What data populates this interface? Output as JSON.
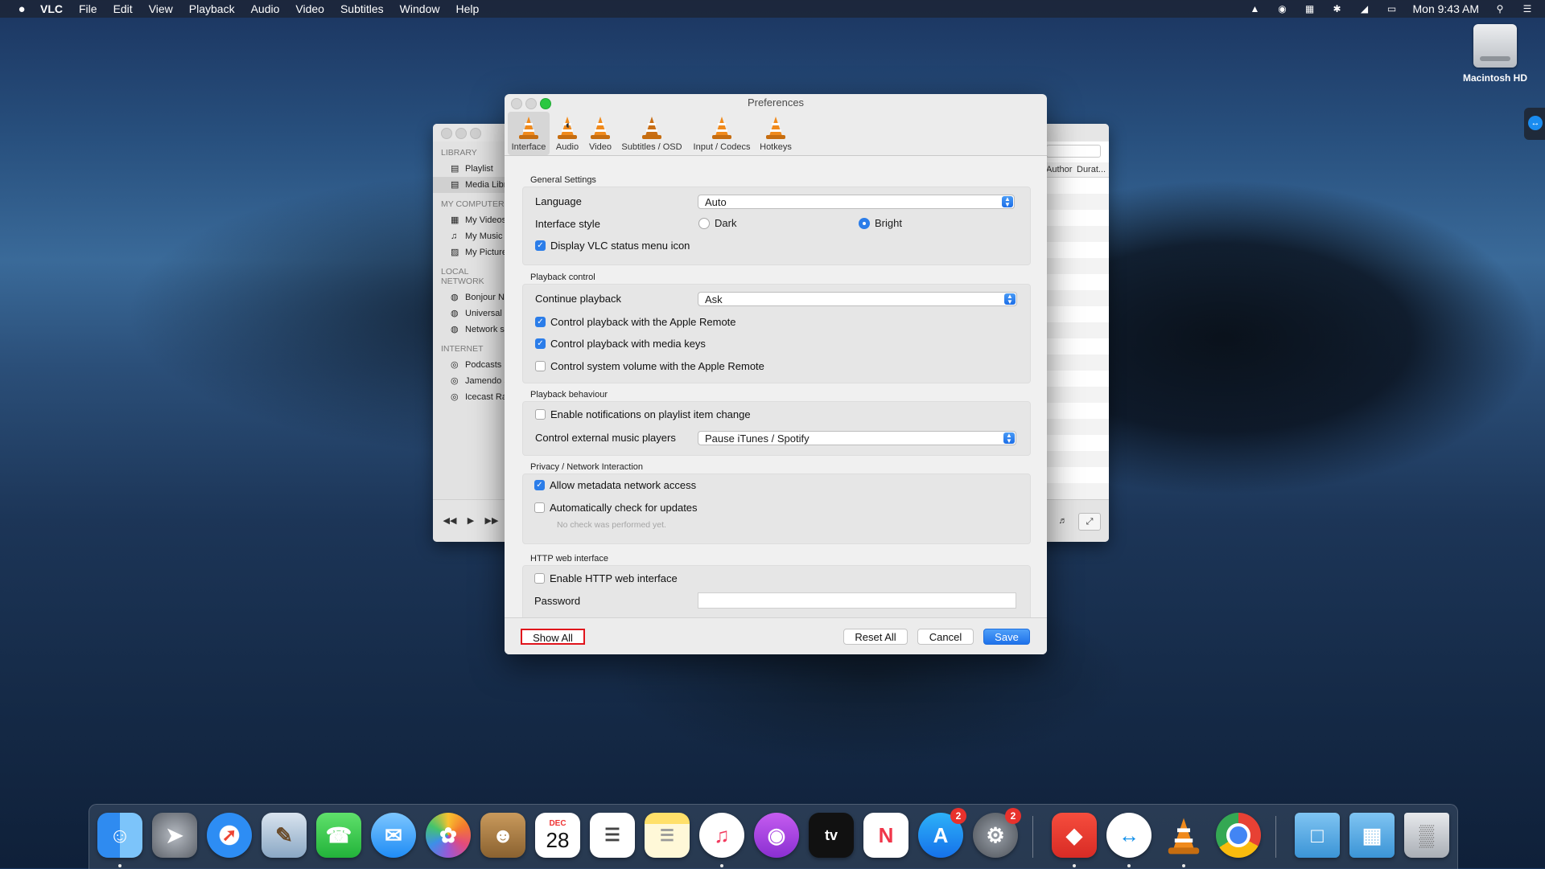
{
  "menubar": {
    "apple": "",
    "app": "VLC",
    "items": [
      "File",
      "Edit",
      "View",
      "Playback",
      "Audio",
      "Video",
      "Subtitles",
      "Window",
      "Help"
    ],
    "clock": "Mon 9:43 AM"
  },
  "desktop": {
    "hd_label": "Macintosh HD"
  },
  "library": {
    "sections": [
      {
        "title": "LIBRARY",
        "items": [
          {
            "label": "Playlist",
            "icon": "▤"
          },
          {
            "label": "Media Library",
            "icon": "▤"
          }
        ]
      },
      {
        "title": "MY COMPUTER",
        "items": [
          {
            "label": "My Videos",
            "icon": "▦"
          },
          {
            "label": "My Music",
            "icon": "♫"
          },
          {
            "label": "My Pictures",
            "icon": "▨"
          }
        ]
      },
      {
        "title": "LOCAL NETWORK",
        "items": [
          {
            "label": "Bonjour Network Discovery",
            "icon": "◍"
          },
          {
            "label": "Universal Plug'n'Play",
            "icon": "◍"
          },
          {
            "label": "Network streams (SAP)",
            "icon": "◍"
          }
        ]
      },
      {
        "title": "INTERNET",
        "items": [
          {
            "label": "Podcasts",
            "icon": "◎"
          },
          {
            "label": "Jamendo Selections",
            "icon": "◎"
          },
          {
            "label": "Icecast Radio Directory",
            "icon": "◎"
          }
        ]
      }
    ],
    "columns": [
      "Author",
      "Durat..."
    ]
  },
  "prefs": {
    "title": "Preferences",
    "tabs": [
      "Interface",
      "Audio",
      "Video",
      "Subtitles / OSD",
      "Input / Codecs",
      "Hotkeys"
    ],
    "general": {
      "title": "General Settings",
      "language_label": "Language",
      "language_value": "Auto",
      "style_label": "Interface style",
      "style_dark": "Dark",
      "style_bright": "Bright",
      "status_icon": "Display VLC status menu icon"
    },
    "playback": {
      "title": "Playback control",
      "continue_label": "Continue playback",
      "continue_value": "Ask",
      "apple_remote": "Control playback with the Apple Remote",
      "media_keys": "Control playback with media keys",
      "system_volume": "Control system volume with the Apple Remote"
    },
    "behaviour": {
      "title": "Playback behaviour",
      "notifications": "Enable notifications on playlist item change",
      "external_label": "Control external music players",
      "external_value": "Pause iTunes / Spotify"
    },
    "privacy": {
      "title": "Privacy / Network Interaction",
      "metadata": "Allow metadata network access",
      "updates": "Automatically check for updates",
      "note": "No check was performed yet."
    },
    "http": {
      "title": "HTTP web interface",
      "enable": "Enable HTTP web interface",
      "password_label": "Password"
    },
    "buttons": {
      "show_all": "Show All",
      "reset_all": "Reset All",
      "cancel": "Cancel",
      "save": "Save"
    }
  },
  "dock": {
    "calendar_month": "DEC",
    "calendar_day": "28",
    "appstore_badge": "2",
    "settings_badge": "2",
    "tv_label": "tv"
  }
}
